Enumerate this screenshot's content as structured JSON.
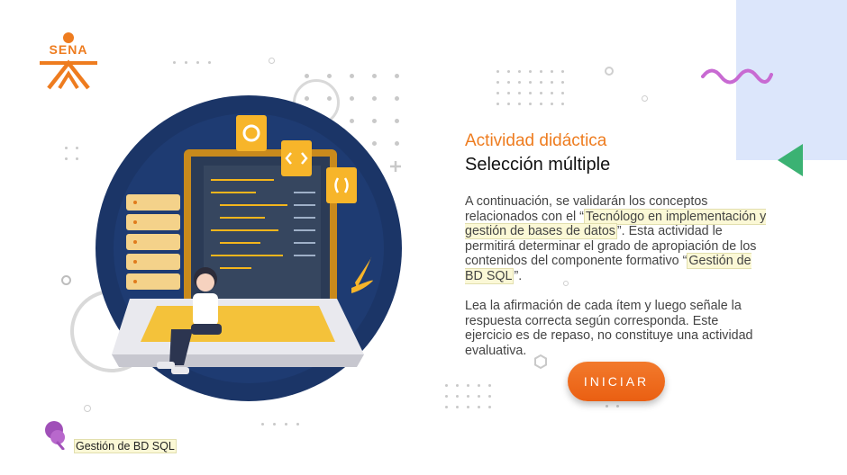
{
  "brand": {
    "logo_text": "SENA",
    "color": "#ee7c1f"
  },
  "activity": {
    "subtitle": "Actividad didáctica",
    "title": "Selección múltiple"
  },
  "intro": {
    "part1": "A continuación, se validarán los conceptos relacionados con el “",
    "highlight1": "Tecnólogo en implementación y gestión de bases de datos",
    "part2": "”. Esta actividad le permitirá determinar el grado de apropiación de los contenidos del componente formativo “",
    "highlight2": "Gestión de BD SQL",
    "part3": "”."
  },
  "instructions": "Lea la afirmación de cada ítem y luego señale la respuesta correcta según corresponda. Este ejercicio es de repaso, no constituye una actividad evaluativa.",
  "start_button": {
    "label": "INICIAR"
  },
  "footer": {
    "component_label": "Gestión de BD SQL",
    "icon": "map-pin-icon"
  },
  "colors": {
    "accent": "#ee7c1f",
    "navy": "#1b3567",
    "panel": "#dce6fb",
    "triangle": "#3bb273",
    "wave": "#c86ad2"
  }
}
